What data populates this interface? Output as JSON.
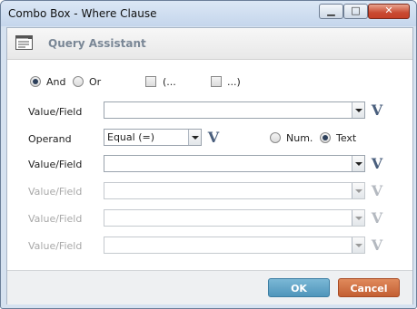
{
  "window": {
    "title": "Combo Box - Where Clause",
    "min_glyph": "▁",
    "max_glyph": "□",
    "close_glyph": "✕"
  },
  "header": {
    "title": "Query Assistant"
  },
  "logic": {
    "and_label": "And",
    "or_label": "Or",
    "open_paren_label": "(...",
    "close_paren_label": "...)",
    "selected": "And"
  },
  "rows": [
    {
      "label": "Value/Field",
      "value": "",
      "enabled": true
    },
    {
      "label": "Operand",
      "value": "Equal (=)",
      "enabled": true
    },
    {
      "label": "Value/Field",
      "value": "",
      "enabled": true
    },
    {
      "label": "Value/Field",
      "value": "",
      "enabled": false
    },
    {
      "label": "Value/Field",
      "value": "",
      "enabled": false
    },
    {
      "label": "Value/Field",
      "value": "",
      "enabled": false
    }
  ],
  "type_options": {
    "num_label": "Num.",
    "text_label": "Text",
    "selected": "Text"
  },
  "v_button_label": "V",
  "footer": {
    "ok_label": "OK",
    "cancel_label": "Cancel"
  }
}
